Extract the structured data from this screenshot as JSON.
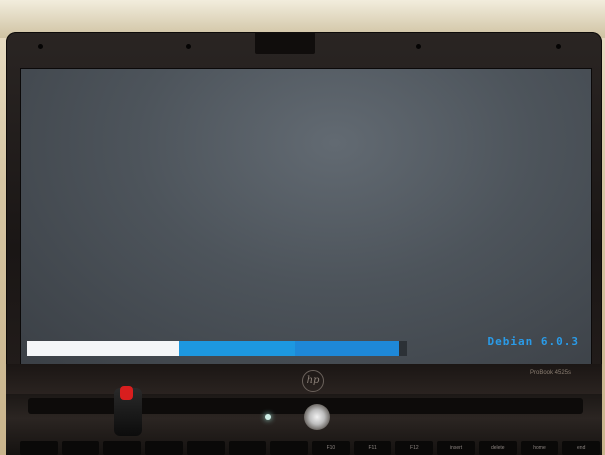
{
  "screen": {
    "brand_text": "Debian 6.0.3",
    "progress": {
      "fraction_complete": 0.4,
      "segments": [
        "white",
        "blue",
        "blue"
      ]
    }
  },
  "colors": {
    "screen_bg": "#4d545b",
    "progress_white": "#f4f6f8",
    "progress_blue": "#1d98e0",
    "brand_text": "#2a9be8",
    "bezel": "#1a1615",
    "usb_cap": "#d81e1e"
  },
  "laptop": {
    "logo_text": "hp",
    "model_text": "ProBook 4525s",
    "keys": [
      "",
      "",
      "",
      "",
      "",
      "",
      "",
      "F10",
      "F11",
      "F12",
      "insert",
      "delete",
      "home",
      "end"
    ]
  }
}
